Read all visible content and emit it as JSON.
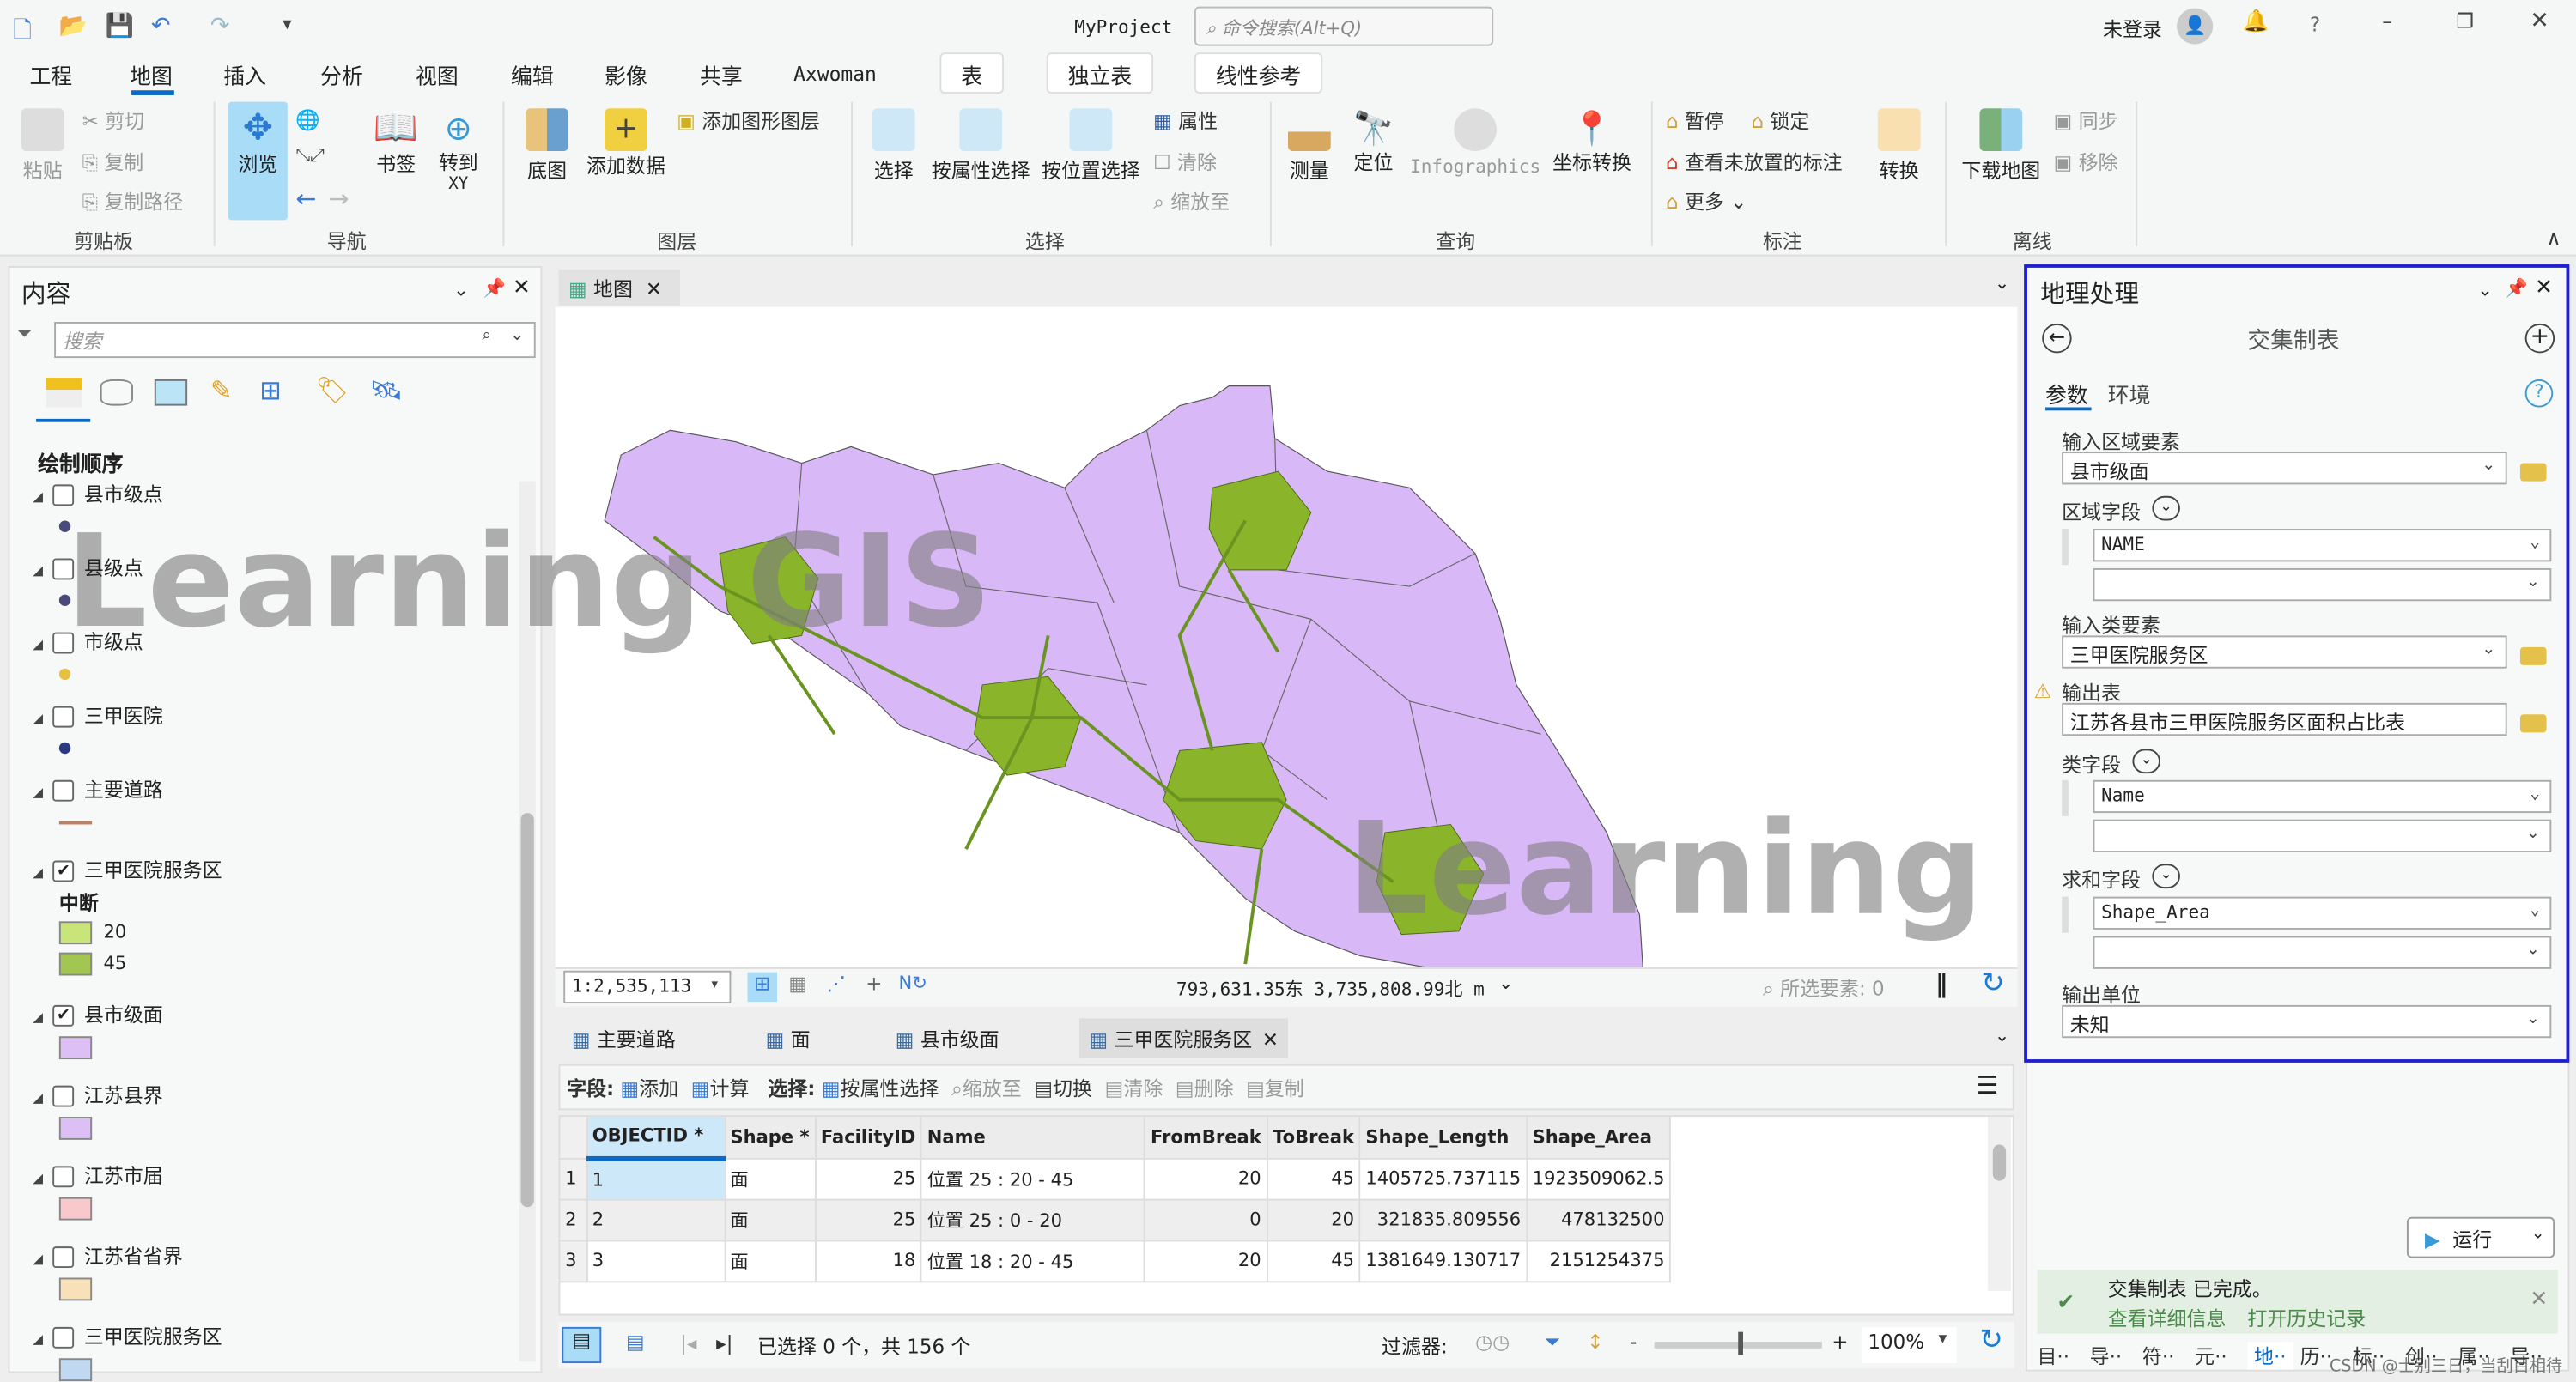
{
  "window": {
    "title": "MyProject",
    "command_search_placeholder": "命令搜索(Alt+Q)",
    "user": "未登录"
  },
  "ribbon_tabs": [
    "工程",
    "地图",
    "插入",
    "分析",
    "视图",
    "编辑",
    "影像",
    "共享",
    "Axwoman"
  ],
  "active_tab": "地图",
  "context_tabs": [
    "表",
    "独立表",
    "线性参考"
  ],
  "ribbon": {
    "clipboard": {
      "group": "剪贴板",
      "paste": "粘贴",
      "cut": "剪切",
      "copy": "复制",
      "copy_path": "复制路径"
    },
    "navigate": {
      "group": "导航",
      "explore": "浏览",
      "bookmarks": "书签",
      "goto_xy": "转到\nXY",
      "goto_xy_1": "转到",
      "goto_xy_2": "XY"
    },
    "layer": {
      "group": "图层",
      "basemap": "底图",
      "add_data": "添加数据",
      "add_graphics": "添加图形图层"
    },
    "selection": {
      "group": "选择",
      "select": "选择",
      "by_attr": "按属性选择",
      "by_loc": "按位置选择",
      "attributes": "属性",
      "clear": "清除",
      "zoom_to": "缩放至"
    },
    "inquiry": {
      "group": "查询",
      "measure": "测量",
      "locate": "定位",
      "infographics": "Infographics",
      "coord": "坐标转换"
    },
    "labeling": {
      "group": "标注",
      "pause": "暂停",
      "lock": "锁定",
      "unplaced": "查看未放置的标注",
      "more": "更多",
      "convert": "转换"
    },
    "offline": {
      "group": "离线",
      "download": "下载地图",
      "sync": "同步",
      "remove": "移除"
    }
  },
  "contents": {
    "title": "内容",
    "search_placeholder": "搜索",
    "section": "绘制顺序",
    "layers": [
      {
        "name": "县市级点",
        "checked": false,
        "symbol": "point",
        "color": "#4a4a7a"
      },
      {
        "name": "县级点",
        "checked": false,
        "symbol": "point",
        "color": "#4a4a7a"
      },
      {
        "name": "市级点",
        "checked": false,
        "symbol": "point",
        "color": "#e8c040"
      },
      {
        "name": "三甲医院",
        "checked": false,
        "symbol": "point",
        "color": "#2a3a80"
      },
      {
        "name": "主要道路",
        "checked": false,
        "symbol": "line",
        "color": "#c08060"
      },
      {
        "name": "三甲医院服务区",
        "checked": true,
        "symbol": "classes",
        "legend_title": "中断",
        "classes": [
          {
            "label": "20",
            "color": "#c9e57a"
          },
          {
            "label": "45",
            "color": "#a3c653"
          }
        ]
      },
      {
        "name": "县市级面",
        "checked": true,
        "symbol": "fill",
        "color": "#dcc0f5"
      },
      {
        "name": "江苏县界",
        "checked": false,
        "symbol": "fill",
        "color": "#dcc0f5"
      },
      {
        "name": "江苏市届",
        "checked": false,
        "symbol": "fill",
        "color": "#f8c8cc"
      },
      {
        "name": "江苏省省界",
        "checked": false,
        "symbol": "fill",
        "color": "#f8e0b8"
      },
      {
        "name": "三甲医院服务区",
        "checked": false,
        "symbol": "fill",
        "color": "#c0d8f0"
      }
    ]
  },
  "map": {
    "tab": "地图",
    "scale": "1:2,535,113",
    "coords": "793,631.35东 3,735,808.99北 m",
    "selected_features": "所选要素: 0",
    "watermark": "Learning GIS",
    "fill_color": "#d9b8f7",
    "service_color": "#8ab42a"
  },
  "table": {
    "tabs": [
      "主要道路",
      "面",
      "县市级面",
      "三甲医院服务区"
    ],
    "active_tab": "三甲医院服务区",
    "toolbar": {
      "field_label": "字段:",
      "add": "添加",
      "calculate": "计算",
      "select_label": "选择:",
      "by_attr": "按属性选择",
      "zoom_to": "缩放至",
      "switch": "切换",
      "clear": "清除",
      "delete": "删除",
      "copy": "复制"
    },
    "columns": [
      "OBJECTID *",
      "Shape *",
      "FacilityID",
      "Name",
      "FromBreak",
      "ToBreak",
      "Shape_Length",
      "Shape_Area"
    ],
    "rows": [
      [
        "1",
        "面",
        "25",
        "位置 25 : 20 - 45",
        "20",
        "45",
        "1405725.737115",
        "1923509062.5"
      ],
      [
        "2",
        "面",
        "25",
        "位置 25 : 0 - 20",
        "0",
        "20",
        "321835.809556",
        "478132500"
      ],
      [
        "3",
        "面",
        "18",
        "位置 18 : 20 - 45",
        "20",
        "45",
        "1381649.130717",
        "2151254375"
      ]
    ],
    "status": "已选择 0 个，共 156 个",
    "filter_label": "过滤器:",
    "zoom": "100%",
    "zoom_level": 0.5
  },
  "geoprocessing": {
    "title": "地理处理",
    "tool": "交集制表",
    "tabs": [
      "参数",
      "环境"
    ],
    "params": {
      "zone_features_label": "输入区域要素",
      "zone_features": "县市级面",
      "zone_fields_label": "区域字段",
      "zone_field": "NAME",
      "class_features_label": "输入类要素",
      "class_features": "三甲医院服务区",
      "output_table_label": "输出表",
      "output_table": "江苏各县市三甲医院服务区面积占比表",
      "class_fields_label": "类字段",
      "class_field": "Name",
      "sum_fields_label": "求和字段",
      "sum_field": "Shape_Area",
      "output_units_label": "输出单位",
      "output_units": "未知"
    },
    "run": "运行",
    "message": "交集制表 已完成。",
    "details_link": "查看详细信息",
    "history_link": "打开历史记录"
  },
  "bottom_tabs": [
    "目··",
    "导··",
    "符··",
    "元··",
    "地··",
    "历··",
    "标··",
    "创··",
    "属··",
    "导··"
  ],
  "active_bottom_tab": "地··",
  "credit_watermark": "CSDN @士别三日，当刮目相待"
}
